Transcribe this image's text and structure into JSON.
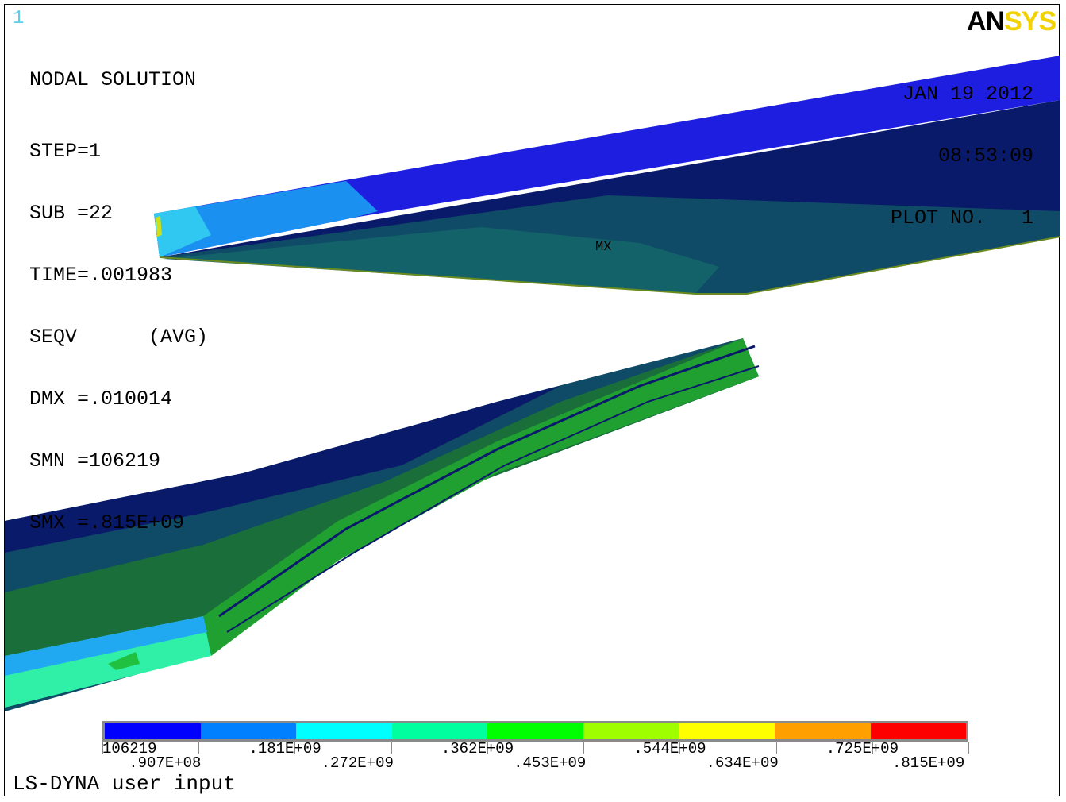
{
  "window_number": "1",
  "logo": {
    "part1": "AN",
    "part2": "SYS"
  },
  "info": {
    "title": "NODAL SOLUTION",
    "lines": [
      "STEP=1",
      "SUB =22",
      "TIME=.001983",
      "SEQV      (AVG)",
      "DMX =.010014",
      "SMN =106219",
      "SMX =.815E+09"
    ]
  },
  "datebox": {
    "date": "JAN 19 2012",
    "time": "08:53:09",
    "plot": "PLOT NO.   1"
  },
  "max_marker": "MX",
  "footer": "LS-DYNA user input",
  "legend": {
    "colors": [
      "#0000ff",
      "#0080ff",
      "#00ffff",
      "#00ff9f",
      "#00ff00",
      "#9fff00",
      "#ffff00",
      "#ff9f00",
      "#ff0000"
    ],
    "labels": [
      "106219",
      ".907E+08",
      ".181E+09",
      ".272E+09",
      ".362E+09",
      ".453E+09",
      ".544E+09",
      ".634E+09",
      ".725E+09",
      ".815E+09"
    ]
  },
  "model_colors": {
    "deep": "#0a1a6a",
    "darkteal": "#0e4a66",
    "teal": "#13626a",
    "blue": "#2020e0",
    "lightblue": "#20a8f0",
    "cyan": "#30e0f0",
    "green": "#20a030",
    "aqua": "#30f0a8"
  }
}
